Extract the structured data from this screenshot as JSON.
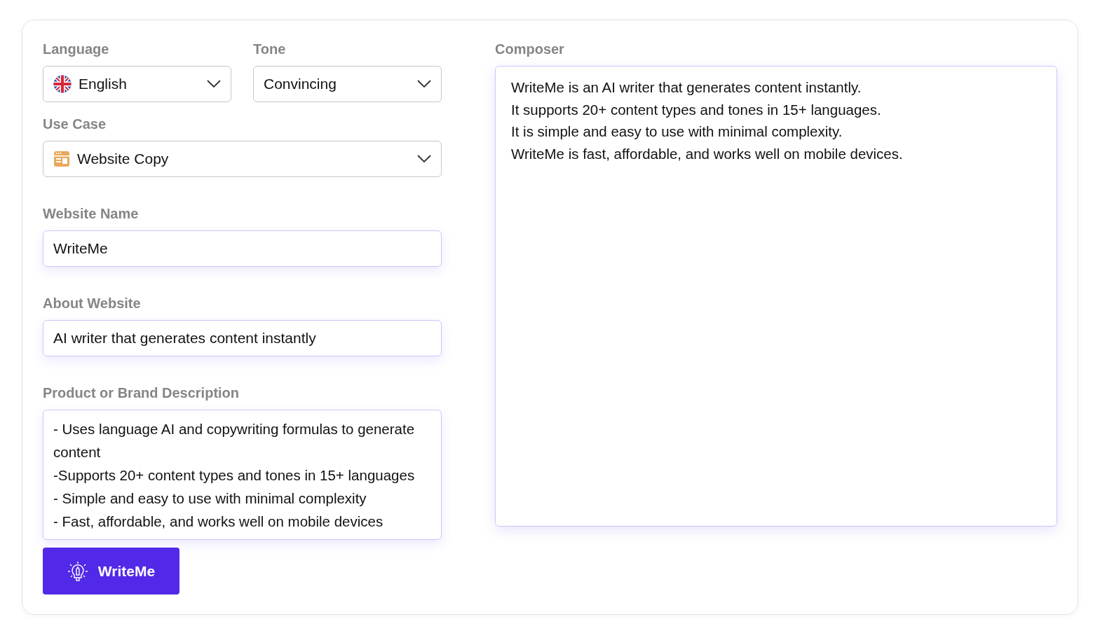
{
  "language": {
    "label": "Language",
    "value": "English"
  },
  "tone": {
    "label": "Tone",
    "value": "Convincing"
  },
  "use_case": {
    "label": "Use Case",
    "value": "Website Copy"
  },
  "website_name": {
    "label": "Website Name",
    "value": "WriteMe"
  },
  "about_website": {
    "label": "About Website",
    "value": "AI writer that generates content instantly"
  },
  "description": {
    "label": "Product or Brand Description",
    "value": "- Uses language AI and copywriting formulas to generate content\n-Supports 20+ content types and tones in 15+ languages\n- Simple and easy to use with minimal complexity\n- Fast, affordable, and works well on mobile devices"
  },
  "composer": {
    "label": "Composer",
    "value": "WriteMe is an AI writer that generates content instantly.\nIt supports 20+ content types and tones in 15+ languages.\nIt is simple and easy to use with minimal complexity.\nWriteMe is fast, affordable, and works well on mobile devices."
  },
  "button": {
    "label": "WriteMe"
  }
}
